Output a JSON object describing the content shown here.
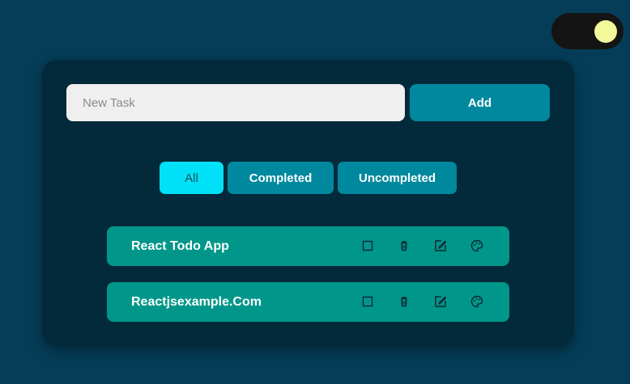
{
  "colors": {
    "page_background": "#053d58",
    "card_background": "#022a3b",
    "accent": "#00899e",
    "active_filter": "#00e1f7",
    "todo_item": "#00978a",
    "toggle_track": "#141414",
    "toggle_knob": "#f2f99a"
  },
  "theme_toggle": {
    "icon": "toggle-switch"
  },
  "new_task": {
    "placeholder": "New Task",
    "value": "",
    "add_label": "Add"
  },
  "filters": {
    "active": "All",
    "items": [
      {
        "label": "All"
      },
      {
        "label": "Completed"
      },
      {
        "label": "Uncompleted"
      }
    ]
  },
  "todos": [
    {
      "text": "React Todo App",
      "actions": [
        "checkbox-icon",
        "trash-icon",
        "edit-icon",
        "palette-icon"
      ]
    },
    {
      "text": "Reactjsexample.Com",
      "actions": [
        "checkbox-icon",
        "trash-icon",
        "edit-icon",
        "palette-icon"
      ]
    }
  ]
}
